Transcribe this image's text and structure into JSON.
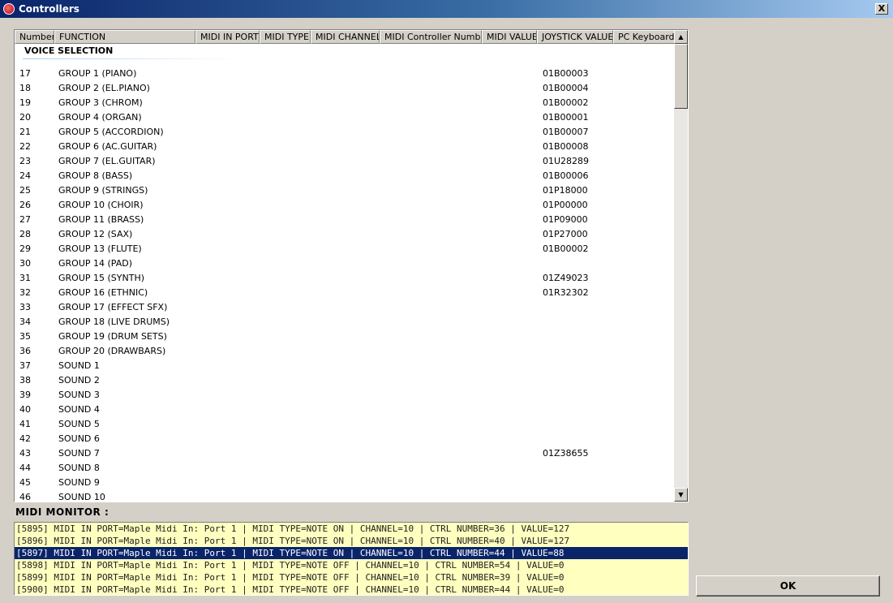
{
  "window": {
    "title": "Controllers",
    "close_label": "X"
  },
  "columns": [
    {
      "label": "Number",
      "width": 49
    },
    {
      "label": "FUNCTION",
      "width": 174
    },
    {
      "label": "MIDI IN PORT",
      "width": 79
    },
    {
      "label": "MIDI TYPE",
      "width": 63
    },
    {
      "label": "MIDI CHANNEL",
      "width": 85
    },
    {
      "label": "MIDI Controller Number",
      "width": 126
    },
    {
      "label": "MIDI VALUE",
      "width": 68
    },
    {
      "label": "JOYSTICK VALUE",
      "width": 94
    },
    {
      "label": "PC Keyboard",
      "width": 76
    }
  ],
  "group": {
    "label": "VOICE SELECTION"
  },
  "rows": [
    {
      "num": "17",
      "fn": "GROUP 1 (PIANO)",
      "joy": "01B00003"
    },
    {
      "num": "18",
      "fn": "GROUP 2 (EL.PIANO)",
      "joy": "01B00004"
    },
    {
      "num": "19",
      "fn": "GROUP 3 (CHROM)",
      "joy": "01B00002"
    },
    {
      "num": "20",
      "fn": "GROUP 4 (ORGAN)",
      "joy": "01B00001"
    },
    {
      "num": "21",
      "fn": "GROUP 5 (ACCORDION)",
      "joy": "01B00007"
    },
    {
      "num": "22",
      "fn": "GROUP 6 (AC.GUITAR)",
      "joy": "01B00008"
    },
    {
      "num": "23",
      "fn": "GROUP 7 (EL.GUITAR)",
      "joy": "01U28289"
    },
    {
      "num": "24",
      "fn": "GROUP 8 (BASS)",
      "joy": "01B00006"
    },
    {
      "num": "25",
      "fn": "GROUP 9 (STRINGS)",
      "joy": "01P18000"
    },
    {
      "num": "26",
      "fn": "GROUP 10 (CHOIR)",
      "joy": "01P00000"
    },
    {
      "num": "27",
      "fn": "GROUP 11 (BRASS)",
      "joy": "01P09000"
    },
    {
      "num": "28",
      "fn": "GROUP 12 (SAX)",
      "joy": "01P27000"
    },
    {
      "num": "29",
      "fn": "GROUP 13 (FLUTE)",
      "joy": "01B00002"
    },
    {
      "num": "30",
      "fn": "GROUP 14 (PAD)",
      "joy": ""
    },
    {
      "num": "31",
      "fn": "GROUP 15 (SYNTH)",
      "joy": "01Z49023"
    },
    {
      "num": "32",
      "fn": "GROUP 16 (ETHNIC)",
      "joy": "01R32302"
    },
    {
      "num": "33",
      "fn": "GROUP 17 (EFFECT SFX)",
      "joy": ""
    },
    {
      "num": "34",
      "fn": "GROUP 18 (LIVE DRUMS)",
      "joy": ""
    },
    {
      "num": "35",
      "fn": "GROUP 19 (DRUM SETS)",
      "joy": ""
    },
    {
      "num": "36",
      "fn": "GROUP 20 (DRAWBARS)",
      "joy": ""
    },
    {
      "num": "37",
      "fn": "SOUND 1",
      "joy": ""
    },
    {
      "num": "38",
      "fn": "SOUND 2",
      "joy": ""
    },
    {
      "num": "39",
      "fn": "SOUND 3",
      "joy": ""
    },
    {
      "num": "40",
      "fn": "SOUND 4",
      "joy": ""
    },
    {
      "num": "41",
      "fn": "SOUND 5",
      "joy": ""
    },
    {
      "num": "42",
      "fn": "SOUND 6",
      "joy": ""
    },
    {
      "num": "43",
      "fn": "SOUND 7",
      "joy": "01Z38655"
    },
    {
      "num": "44",
      "fn": "SOUND 8",
      "joy": ""
    },
    {
      "num": "45",
      "fn": "SOUND 9",
      "joy": ""
    },
    {
      "num": "46",
      "fn": "SOUND 10",
      "joy": ""
    }
  ],
  "monitor": {
    "label": "MIDI MONITOR :",
    "lines": [
      {
        "text": "[5895] MIDI IN PORT=Maple Midi In: Port 1 | MIDI TYPE=NOTE ON | CHANNEL=10 | CTRL NUMBER=36 | VALUE=127",
        "selected": false
      },
      {
        "text": "[5896] MIDI IN PORT=Maple Midi In: Port 1 | MIDI TYPE=NOTE ON | CHANNEL=10 | CTRL NUMBER=40 | VALUE=127",
        "selected": false
      },
      {
        "text": "[5897] MIDI IN PORT=Maple Midi In: Port 1 | MIDI TYPE=NOTE ON | CHANNEL=10 | CTRL NUMBER=44 | VALUE=88",
        "selected": true
      },
      {
        "text": "[5898] MIDI IN PORT=Maple Midi In: Port 1 | MIDI TYPE=NOTE OFF | CHANNEL=10 | CTRL NUMBER=54 | VALUE=0",
        "selected": false
      },
      {
        "text": "[5899] MIDI IN PORT=Maple Midi In: Port 1 | MIDI TYPE=NOTE OFF | CHANNEL=10 | CTRL NUMBER=39 | VALUE=0",
        "selected": false
      },
      {
        "text": "[5900] MIDI IN PORT=Maple Midi In: Port 1 | MIDI TYPE=NOTE OFF | CHANNEL=10 | CTRL NUMBER=44 | VALUE=0",
        "selected": false
      }
    ]
  },
  "ok_button": {
    "label": "OK"
  }
}
